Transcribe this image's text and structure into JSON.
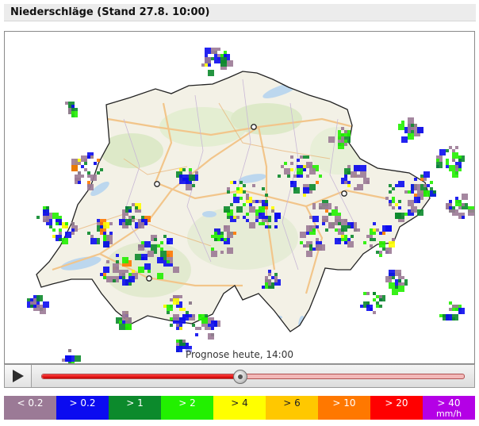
{
  "header": {
    "title": "Niederschläge (Stand 27.8. 10:00)"
  },
  "map": {
    "forecast_label": "Prognose heute, 14:00",
    "colors": {
      "land": "#f3f1e6",
      "forest": "#dde9c8",
      "lake": "#bcd7ee",
      "roads": "#f2c58a",
      "border": "#222222"
    },
    "cities": [
      "city-north",
      "city-east",
      "city-west",
      "city-southwest"
    ]
  },
  "player": {
    "play_icon": "play-icon",
    "progress": 0.47
  },
  "legend": {
    "items": [
      {
        "label": "< 0.2",
        "color": "#9b7a96",
        "text_color": "#ffffff"
      },
      {
        "label": "> 0.2",
        "color": "#0b0bf0",
        "text_color": "#ffffff"
      },
      {
        "label": "> 1",
        "color": "#0c8a2c",
        "text_color": "#ffffff"
      },
      {
        "label": "> 2",
        "color": "#22f000",
        "text_color": "#ffffff"
      },
      {
        "label": "> 4",
        "color": "#ffff00",
        "text_color": "#222222"
      },
      {
        "label": "> 6",
        "color": "#ffc800",
        "text_color": "#222222"
      },
      {
        "label": "> 10",
        "color": "#ff7800",
        "text_color": "#ffffff"
      },
      {
        "label": "> 20",
        "color": "#ff0000",
        "text_color": "#ffffff"
      },
      {
        "label": "> 40",
        "unit": "mm/h",
        "color": "#b400e6",
        "text_color": "#ffffff"
      }
    ]
  }
}
